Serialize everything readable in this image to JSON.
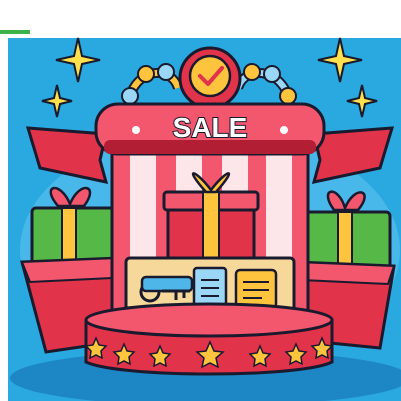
{
  "illustration": {
    "sign_text": "SALE",
    "colors": {
      "sky": "#29a9e0",
      "pink": "#f2576e",
      "red": "#e1334a",
      "dark_red": "#b21f34",
      "gold": "#ffc43d",
      "green": "#56b947",
      "cream": "#f6d89a",
      "outline": "#1a1a2e",
      "white": "#ffffff"
    },
    "icons": [
      "sparkle-icon",
      "checkmark-badge-icon",
      "gift-box-icon",
      "key-icon",
      "receipt-icon",
      "coupon-icon",
      "star-icon"
    ]
  }
}
